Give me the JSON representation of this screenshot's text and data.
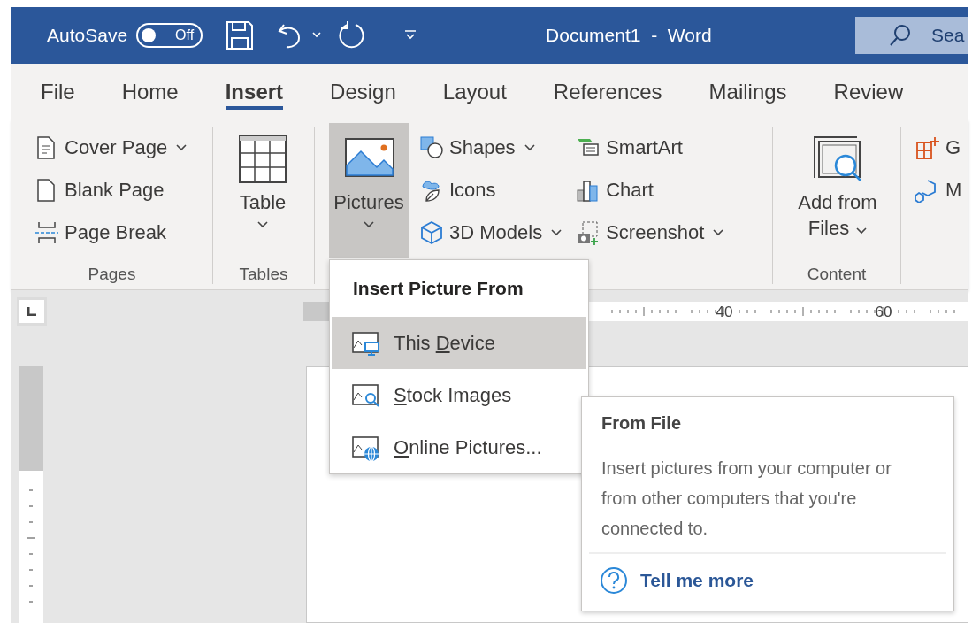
{
  "title_bar": {
    "autosave_label": "AutoSave",
    "autosave_toggle": {
      "on": false,
      "label": "Off"
    },
    "document_title": "Document1  -  Word",
    "search": {
      "text": "Sea"
    }
  },
  "tabs": [
    {
      "label": "File",
      "selected": false
    },
    {
      "label": "Home",
      "selected": false
    },
    {
      "label": "Insert",
      "selected": true
    },
    {
      "label": "Design",
      "selected": false
    },
    {
      "label": "Layout",
      "selected": false
    },
    {
      "label": "References",
      "selected": false
    },
    {
      "label": "Mailings",
      "selected": false
    },
    {
      "label": "Review",
      "selected": false
    }
  ],
  "ribbon": {
    "groups": [
      {
        "label": "Pages",
        "columns": [
          [
            {
              "kind": "small",
              "label": "Cover Page",
              "dropdown": true
            },
            {
              "kind": "small",
              "label": "Blank Page",
              "dropdown": false
            },
            {
              "kind": "small",
              "label": "Page Break",
              "dropdown": false
            }
          ]
        ]
      },
      {
        "label": "Tables",
        "columns": [
          [
            {
              "kind": "large",
              "label": "Table",
              "dropdown": true,
              "pressed": false
            }
          ]
        ]
      },
      {
        "columns": [
          [
            {
              "kind": "large",
              "label": "Pictures",
              "dropdown": true,
              "pressed": true
            }
          ],
          [
            {
              "kind": "small",
              "label": "Shapes",
              "dropdown": true
            },
            {
              "kind": "small",
              "label": "Icons",
              "dropdown": false
            },
            {
              "kind": "small",
              "label": "3D Models",
              "dropdown": true
            }
          ],
          [
            {
              "kind": "small",
              "label": "SmartArt",
              "dropdown": false
            },
            {
              "kind": "small",
              "label": "Chart",
              "dropdown": false
            },
            {
              "kind": "small",
              "label": "Screenshot",
              "dropdown": true
            }
          ]
        ]
      },
      {
        "label": "Content",
        "columns": [
          [
            {
              "kind": "large",
              "label": "Add from Files",
              "dropdown": true,
              "pressed": false
            }
          ]
        ]
      },
      {
        "columns": [
          [
            {
              "kind": "small",
              "label": "G",
              "dropdown": false
            },
            {
              "kind": "small",
              "label": "M",
              "dropdown": false
            }
          ]
        ]
      }
    ]
  },
  "ruler": {
    "labels": [
      "40",
      "60"
    ]
  },
  "picture_menu": {
    "title": "Insert Picture From",
    "items": [
      {
        "before": "This ",
        "key": "D",
        "after": "evice",
        "selected": true
      },
      {
        "key": "S",
        "after": "tock Images",
        "selected": false
      },
      {
        "key": "O",
        "after": "nline Pictures...",
        "selected": false
      }
    ]
  },
  "tooltip": {
    "title": "From File",
    "body": "Insert pictures from your computer or from other computers that you're connected to.",
    "link": "Tell me more"
  }
}
